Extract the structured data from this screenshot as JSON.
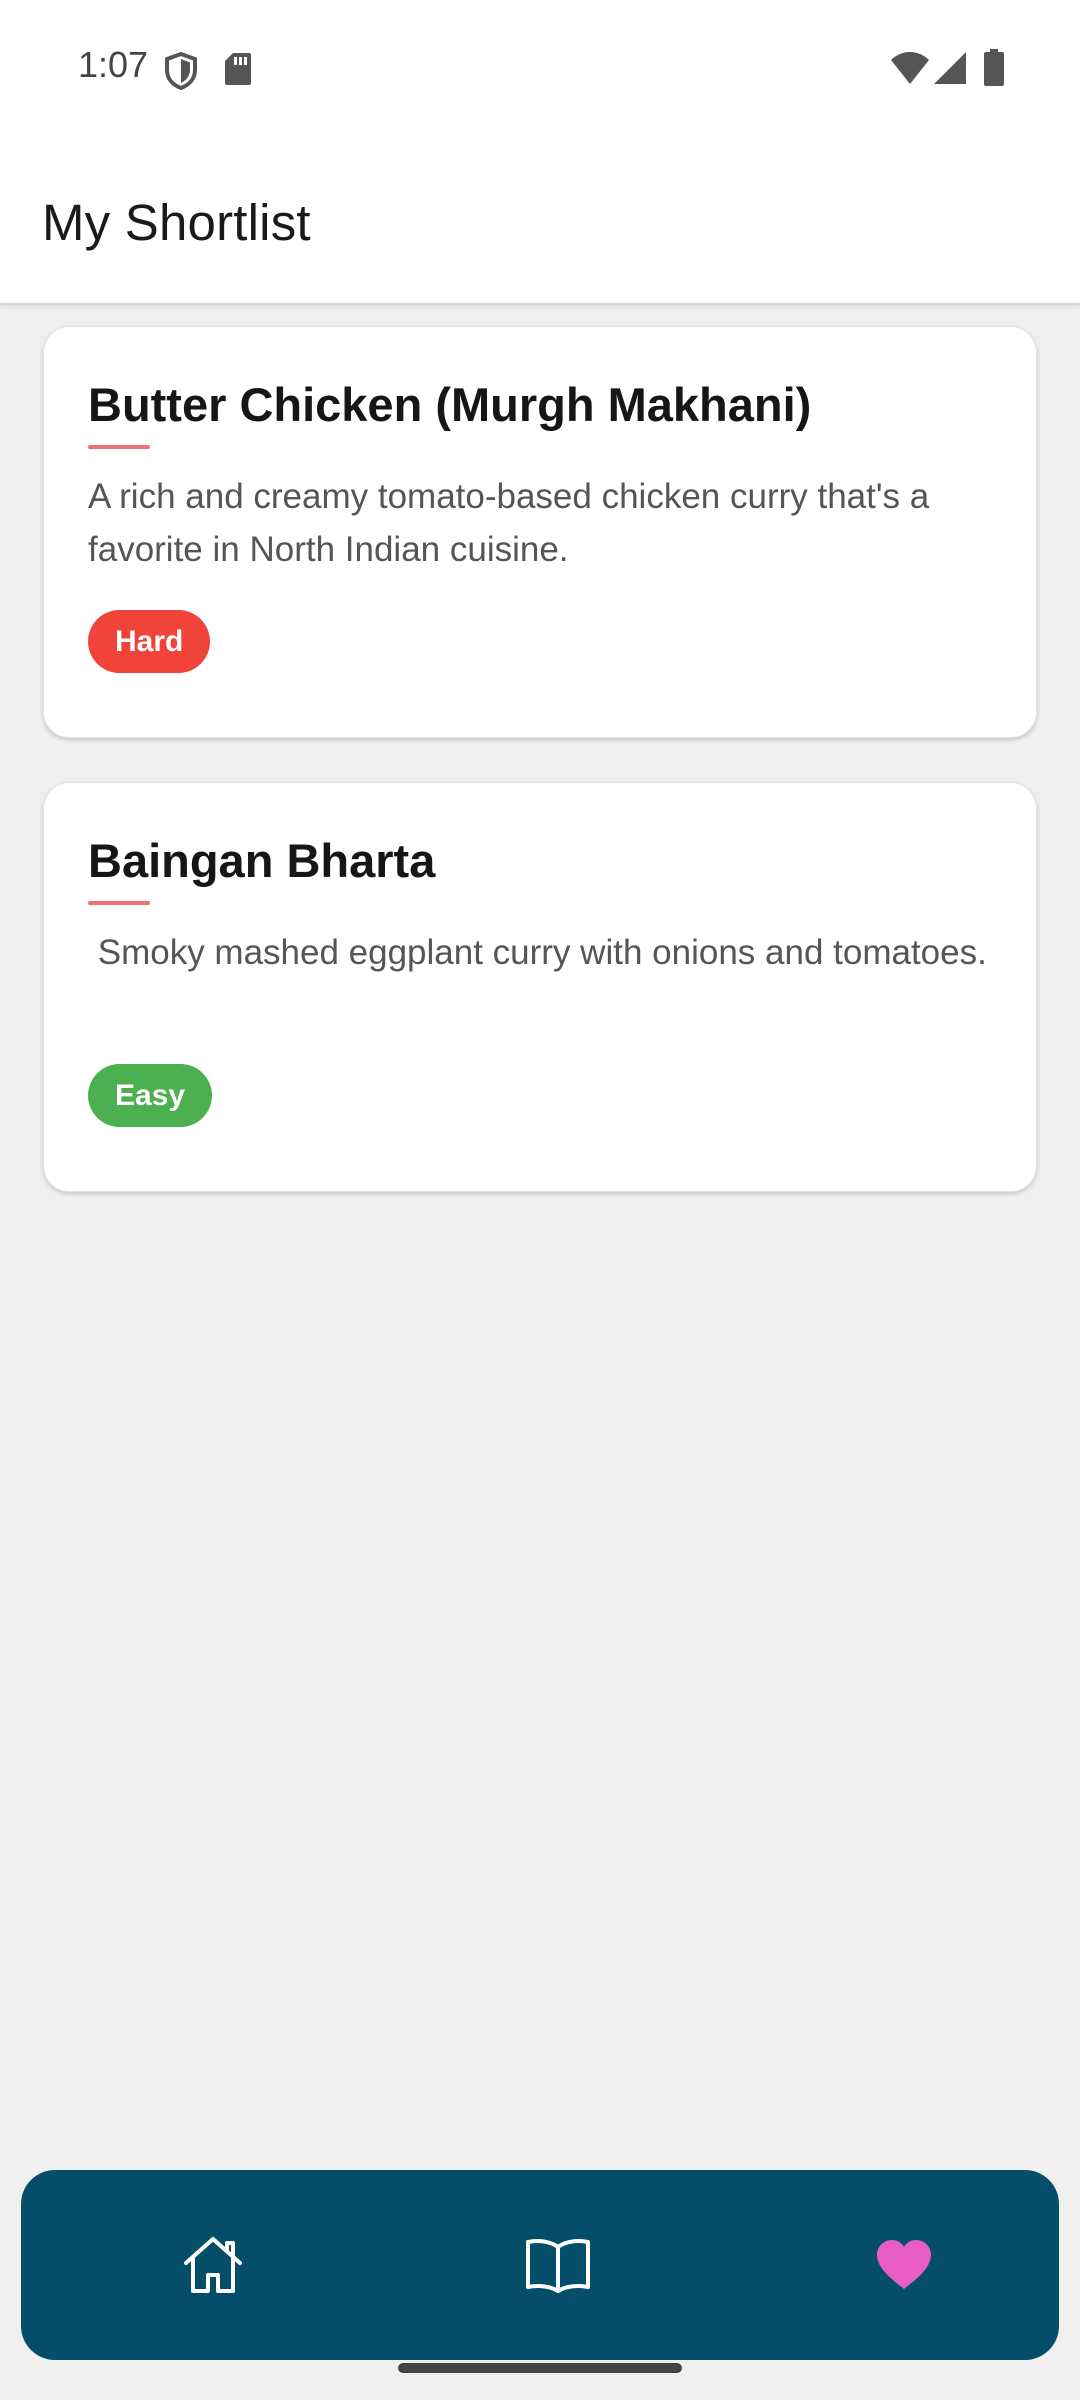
{
  "status_bar": {
    "time": "1:07",
    "icons": [
      "shield-icon",
      "sd-card-icon",
      "wifi-icon",
      "signal-icon",
      "battery-icon"
    ]
  },
  "app_bar": {
    "title": "My Shortlist"
  },
  "shortlist": [
    {
      "title": "Butter Chicken (Murgh Makhani)",
      "description": "A rich and creamy tomato-based chicken curry that's a favorite in North Indian cuisine.",
      "difficulty": "Hard",
      "difficulty_color": "#f0443a"
    },
    {
      "title": "Baingan Bharta",
      "description": " Smoky mashed eggplant curry with onions and tomatoes.",
      "difficulty": "Easy",
      "difficulty_color": "#4caf50"
    }
  ],
  "bottom_nav": {
    "items": [
      {
        "icon": "home-icon",
        "active": false
      },
      {
        "icon": "book-icon",
        "active": false
      },
      {
        "icon": "heart-icon",
        "active": true
      }
    ],
    "background": "#044e6a",
    "active_color": "#e85cc6",
    "inactive_color": "#ffffff"
  },
  "colors": {
    "accent_underline": "#f0707a",
    "page_background": "#f0f0f0"
  }
}
